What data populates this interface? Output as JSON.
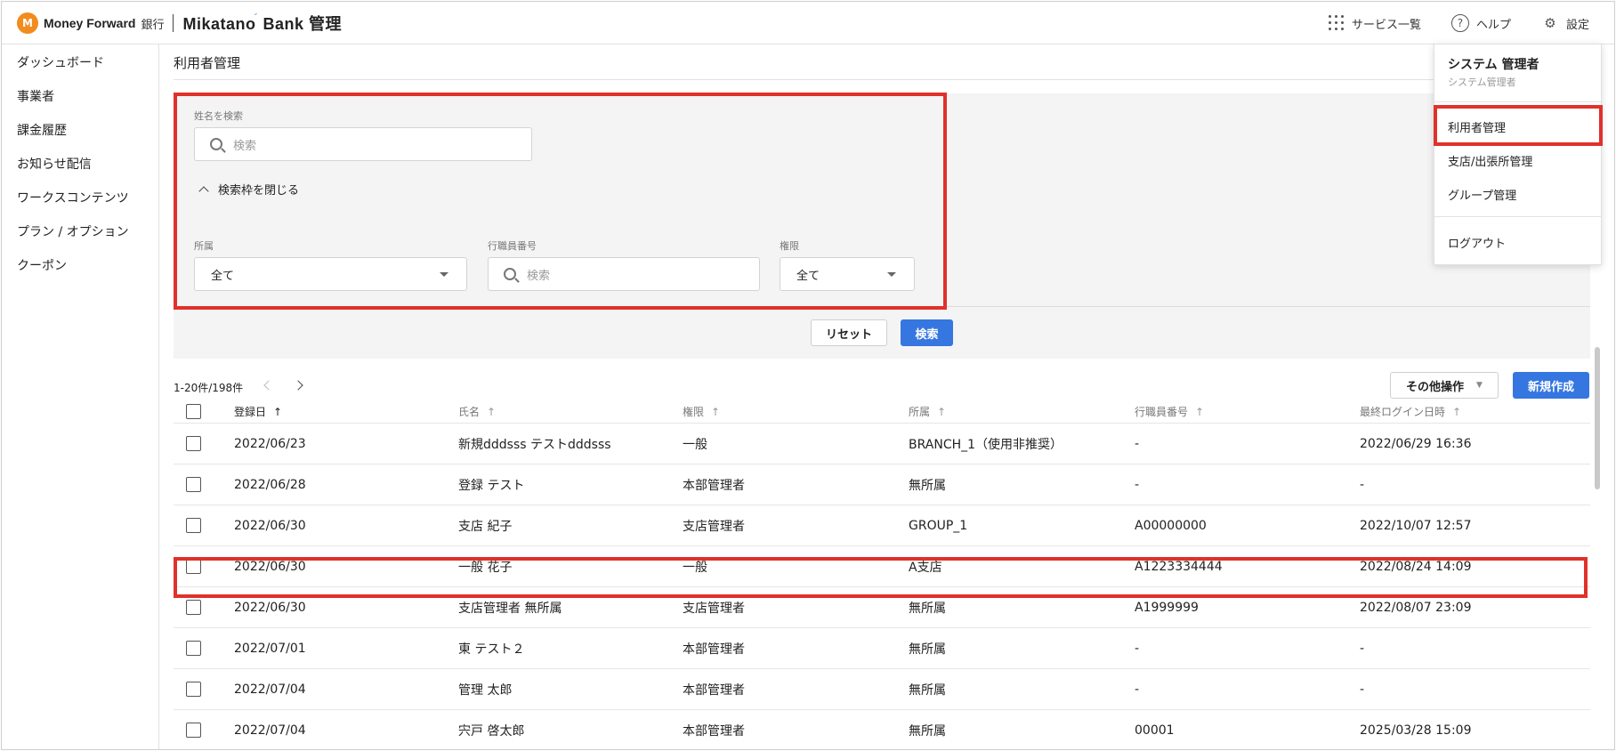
{
  "header": {
    "brand": "Money Forward",
    "brand_bank": "銀行",
    "product": "Mikatano",
    "product_suffix": "Bank 管理",
    "services_label": "サービス一覧",
    "help_label": "ヘルプ",
    "settings_label": "設定"
  },
  "sidebar": {
    "items": [
      {
        "label": "ダッシュボード"
      },
      {
        "label": "事業者"
      },
      {
        "label": "課金履歴"
      },
      {
        "label": "お知らせ配信"
      },
      {
        "label": "ワークスコンテンツ"
      },
      {
        "label": "プラン / オプション"
      },
      {
        "label": "クーポン"
      }
    ]
  },
  "page": {
    "title": "利用者管理"
  },
  "search": {
    "name_label": "姓名を検索",
    "name_placeholder": "検索",
    "collapse_label": "検索枠を閉じる",
    "affiliation_label": "所属",
    "affiliation_value": "全て",
    "staff_no_label": "行職員番号",
    "staff_no_placeholder": "検索",
    "role_label": "権限",
    "role_value": "全て",
    "reset_label": "リセット",
    "search_label": "検索"
  },
  "list": {
    "count": "1-20件/198件",
    "other_ops_label": "その他操作",
    "new_label": "新規作成",
    "columns": [
      "登録日",
      "氏名",
      "権限",
      "所属",
      "行職員番号",
      "最終ログイン日時"
    ],
    "rows": [
      {
        "date": "2022/06/23",
        "name": "新規dddsss テストdddsss",
        "role": "一般",
        "affiliation": "BRANCH_1（使用非推奨）",
        "staff_no": "-",
        "last_login": "2022/06/29 16:36"
      },
      {
        "date": "2022/06/28",
        "name": "登録 テスト",
        "role": "本部管理者",
        "affiliation": "無所属",
        "staff_no": "-",
        "last_login": "-"
      },
      {
        "date": "2022/06/30",
        "name": "支店 紀子",
        "role": "支店管理者",
        "affiliation": "GROUP_1",
        "staff_no": "A00000000",
        "last_login": "2022/10/07 12:57"
      },
      {
        "date": "2022/06/30",
        "name": "一般 花子",
        "role": "一般",
        "affiliation": "A支店",
        "staff_no": "A1223334444",
        "last_login": "2022/08/24 14:09"
      },
      {
        "date": "2022/06/30",
        "name": "支店管理者 無所属",
        "role": "支店管理者",
        "affiliation": "無所属",
        "staff_no": "A1999999",
        "last_login": "2022/08/07 23:09"
      },
      {
        "date": "2022/07/01",
        "name": "東 テスト２",
        "role": "本部管理者",
        "affiliation": "無所属",
        "staff_no": "-",
        "last_login": "-"
      },
      {
        "date": "2022/07/04",
        "name": "管理 太郎",
        "role": "本部管理者",
        "affiliation": "無所属",
        "staff_no": "-",
        "last_login": "-"
      },
      {
        "date": "2022/07/04",
        "name": "宍戸 啓太郎",
        "role": "本部管理者",
        "affiliation": "無所属",
        "staff_no": "00001",
        "last_login": "2025/03/28 15:09"
      }
    ]
  },
  "user_menu": {
    "name": "システム 管理者",
    "role": "システム管理者",
    "items": [
      {
        "label": "利用者管理"
      },
      {
        "label": "支店/出張所管理"
      },
      {
        "label": "グループ管理"
      },
      {
        "label": "ログアウト"
      }
    ]
  },
  "colors": {
    "accent": "#3576e0",
    "brand": "#f28c1e",
    "highlight": "#e0312a"
  }
}
